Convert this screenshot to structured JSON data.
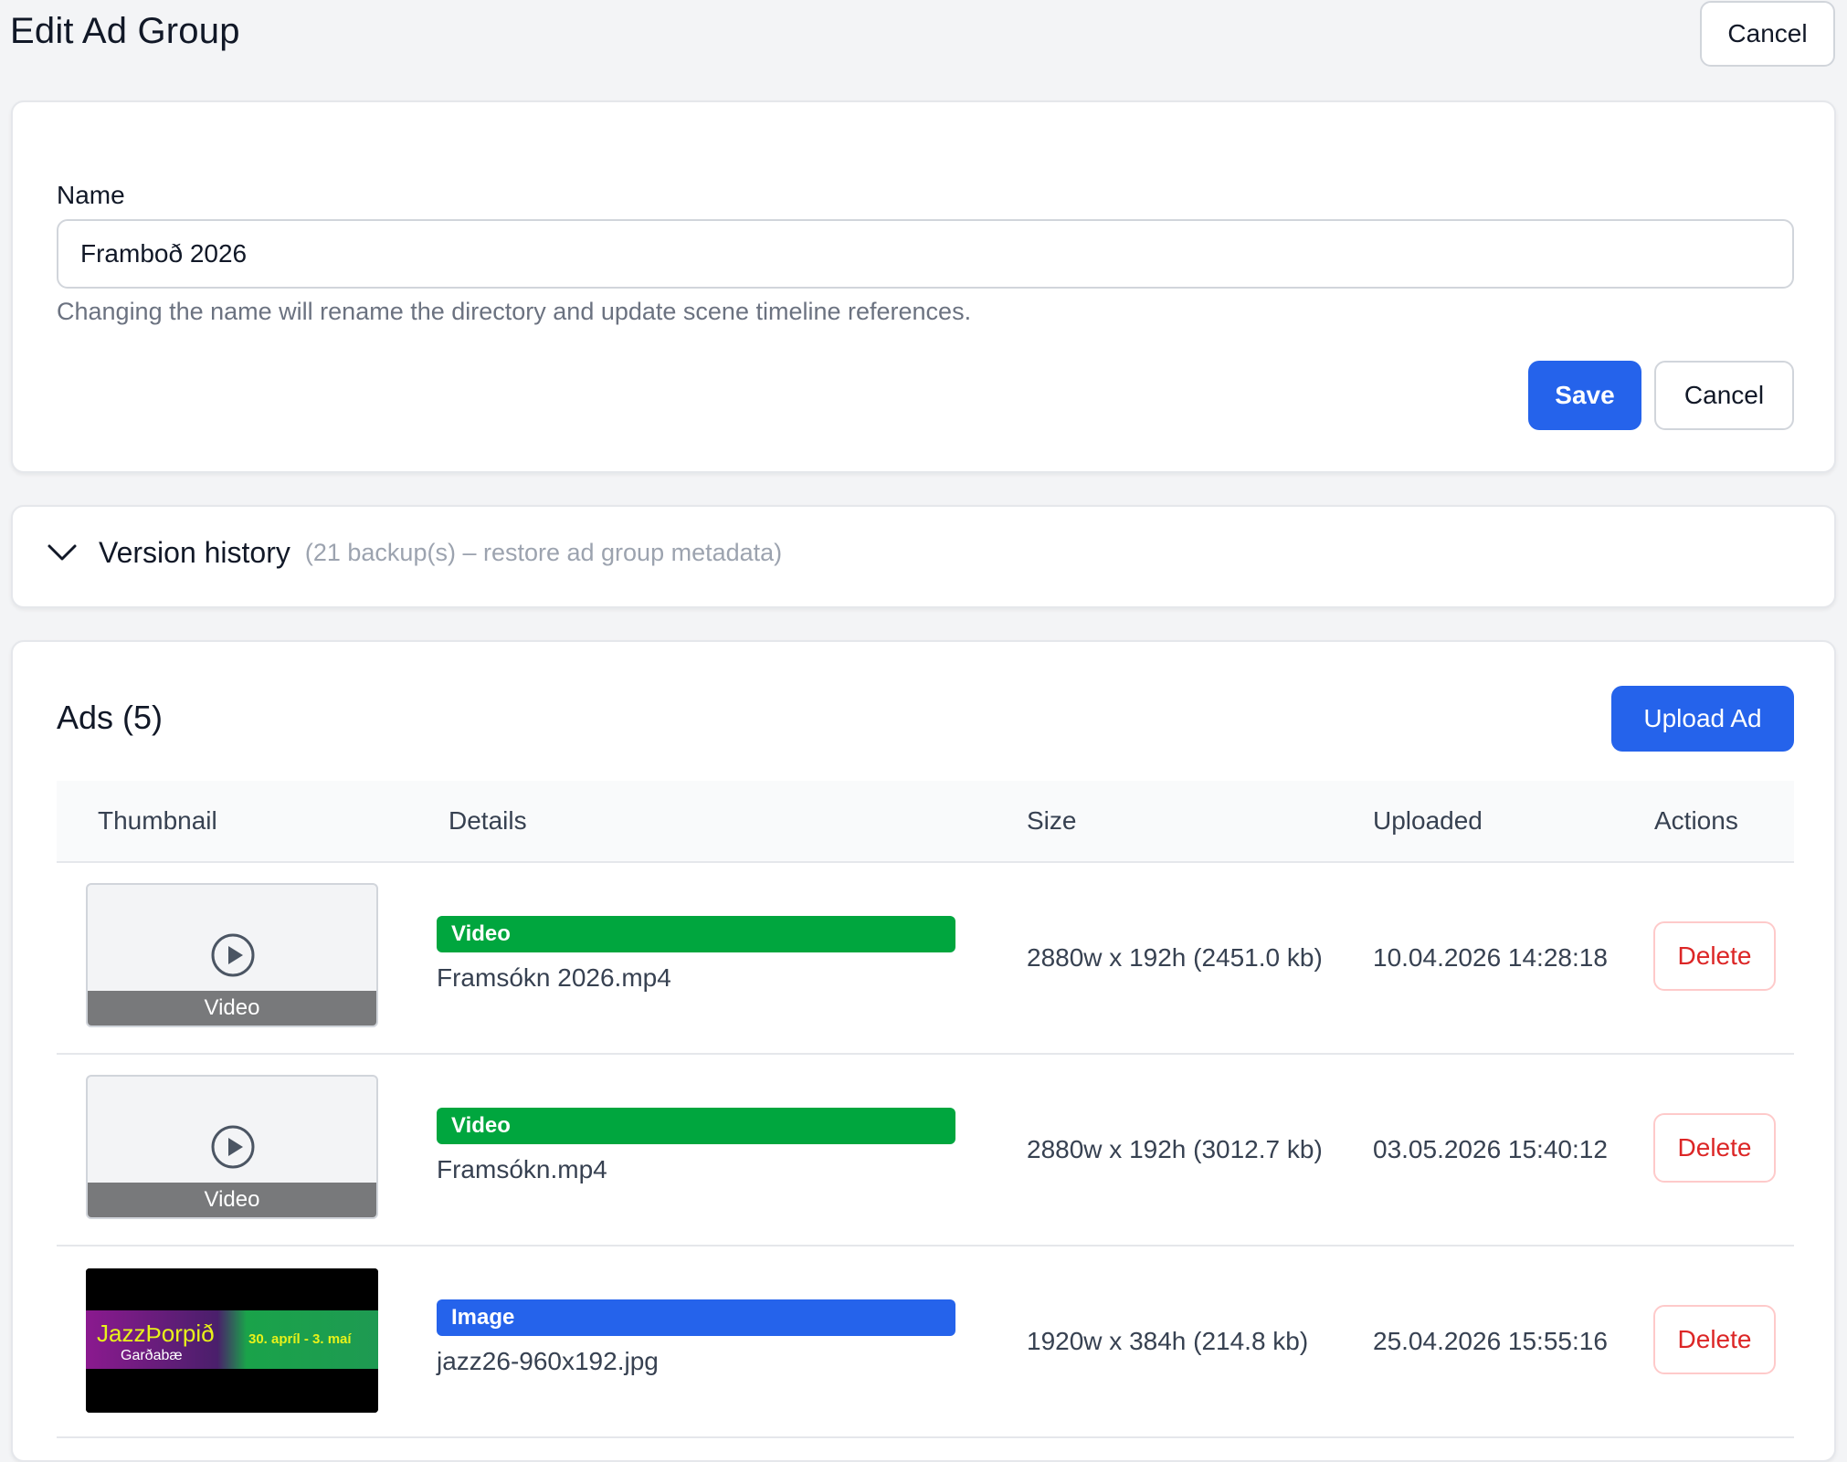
{
  "page": {
    "title": "Edit Ad Group",
    "cancel_label": "Cancel"
  },
  "name_form": {
    "label": "Name",
    "value": "Framboð 2026",
    "hint": "Changing the name will rename the directory and update scene timeline references.",
    "save_label": "Save",
    "cancel_label": "Cancel"
  },
  "version_history": {
    "title": "Version history",
    "subtitle": "(21 backup(s) – restore ad group metadata)",
    "icon": "chevron-down-icon"
  },
  "ads": {
    "title": "Ads (5)",
    "upload_label": "Upload Ad",
    "columns": [
      "Thumbnail",
      "Details",
      "Size",
      "Uploaded",
      "Actions"
    ],
    "rows": [
      {
        "thumb_type": "video",
        "thumb_label": "Video",
        "badge": "Video",
        "badge_color": "#00a63e",
        "filename": "Framsókn 2026.mp4",
        "size": "2880w x 192h (2451.0 kb)",
        "uploaded": "10.04.2026 14:28:18",
        "action": "Delete"
      },
      {
        "thumb_type": "video",
        "thumb_label": "Video",
        "badge": "Video",
        "badge_color": "#00a63e",
        "filename": "Framsókn.mp4",
        "size": "2880w x 192h (3012.7 kb)",
        "uploaded": "03.05.2026 15:40:12",
        "action": "Delete"
      },
      {
        "thumb_type": "image",
        "thumb_text_main": "JazzÞorpið",
        "thumb_text_sub": "Garðabæ",
        "thumb_text_dates": "30. apríl - 3. maí",
        "badge": "Image",
        "badge_color": "#2563eb",
        "filename": "jazz26-960x192.jpg",
        "size": "1920w x 384h (214.8 kb)",
        "uploaded": "25.04.2026 15:55:16",
        "action": "Delete"
      }
    ]
  },
  "colors": {
    "primary": "#2563eb",
    "danger": "#dc2626",
    "video_badge": "#00a63e"
  }
}
